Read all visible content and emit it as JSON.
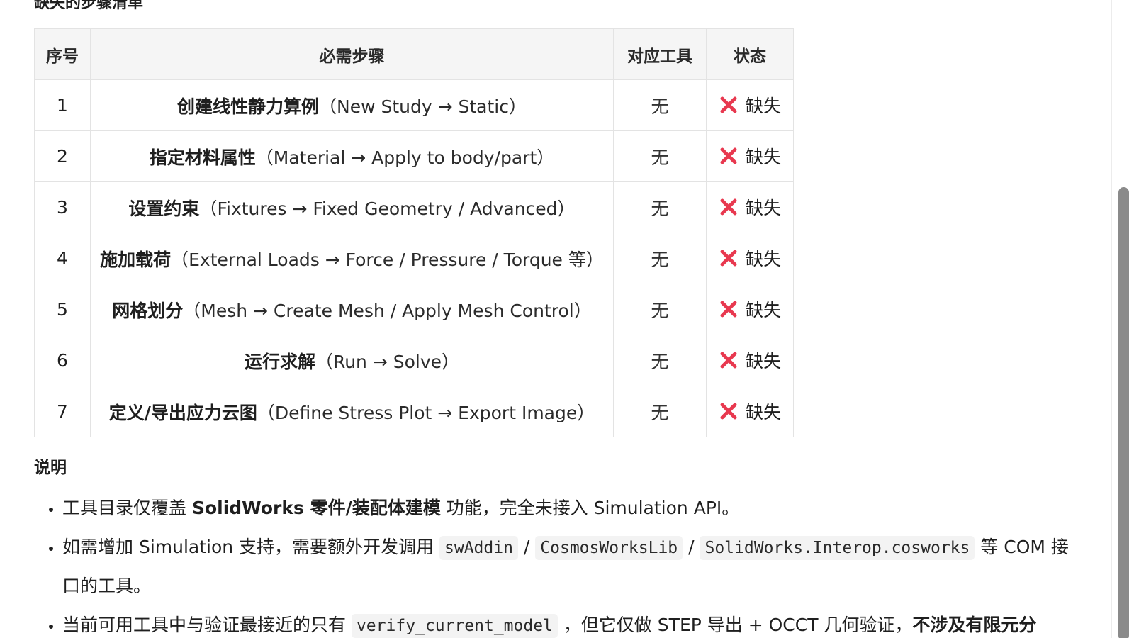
{
  "section_heading": "缺失的步骤清单",
  "table": {
    "headers": [
      "序号",
      "必需步骤",
      "对应工具",
      "状态"
    ],
    "rows": [
      {
        "no": "1",
        "step_cn": "创建线性静力算例",
        "step_en": "（New Study → Static）",
        "tool": "无",
        "status": "缺失"
      },
      {
        "no": "2",
        "step_cn": "指定材料属性",
        "step_en": "（Material → Apply to body/part）",
        "tool": "无",
        "status": "缺失"
      },
      {
        "no": "3",
        "step_cn": "设置约束",
        "step_en": "（Fixtures → Fixed Geometry / Advanced）",
        "tool": "无",
        "status": "缺失"
      },
      {
        "no": "4",
        "step_cn": "施加载荷",
        "step_en": "（External Loads → Force / Pressure / Torque 等）",
        "tool": "无",
        "status": "缺失"
      },
      {
        "no": "5",
        "step_cn": "网格划分",
        "step_en": "（Mesh → Create Mesh / Apply Mesh Control）",
        "tool": "无",
        "status": "缺失"
      },
      {
        "no": "6",
        "step_cn": "运行求解",
        "step_en": "（Run → Solve）",
        "tool": "无",
        "status": "缺失"
      },
      {
        "no": "7",
        "step_cn": "定义/导出应力云图",
        "step_en": "（Define Stress Plot → Export Image）",
        "tool": "无",
        "status": "缺失"
      }
    ]
  },
  "status_icon": "cross-mark-icon",
  "status_icon_color": "#e8384f",
  "notes": {
    "title": "说明",
    "item1": {
      "prefix": "工具目录仅覆盖 ",
      "bold": "SolidWorks 零件/装配体建模",
      "suffix": " 功能，完全未接入 Simulation API。"
    },
    "item2": {
      "prefix": "如需增加 Simulation 支持，需要额外开发调用 ",
      "code1": "swAddin",
      "sep1": " / ",
      "code2": "CosmosWorksLib",
      "sep2": " / ",
      "code3": "SolidWorks.Interop.cosworks",
      "suffix": " 等 COM 接口的工具。"
    },
    "item3": {
      "prefix": "当前可用工具中与验证最接近的只有 ",
      "code1": "verify_current_model",
      "middle": " ，但它仅做 STEP 导出 + OCCT 几何验证，",
      "bold": "不涉及有限元分"
    }
  }
}
